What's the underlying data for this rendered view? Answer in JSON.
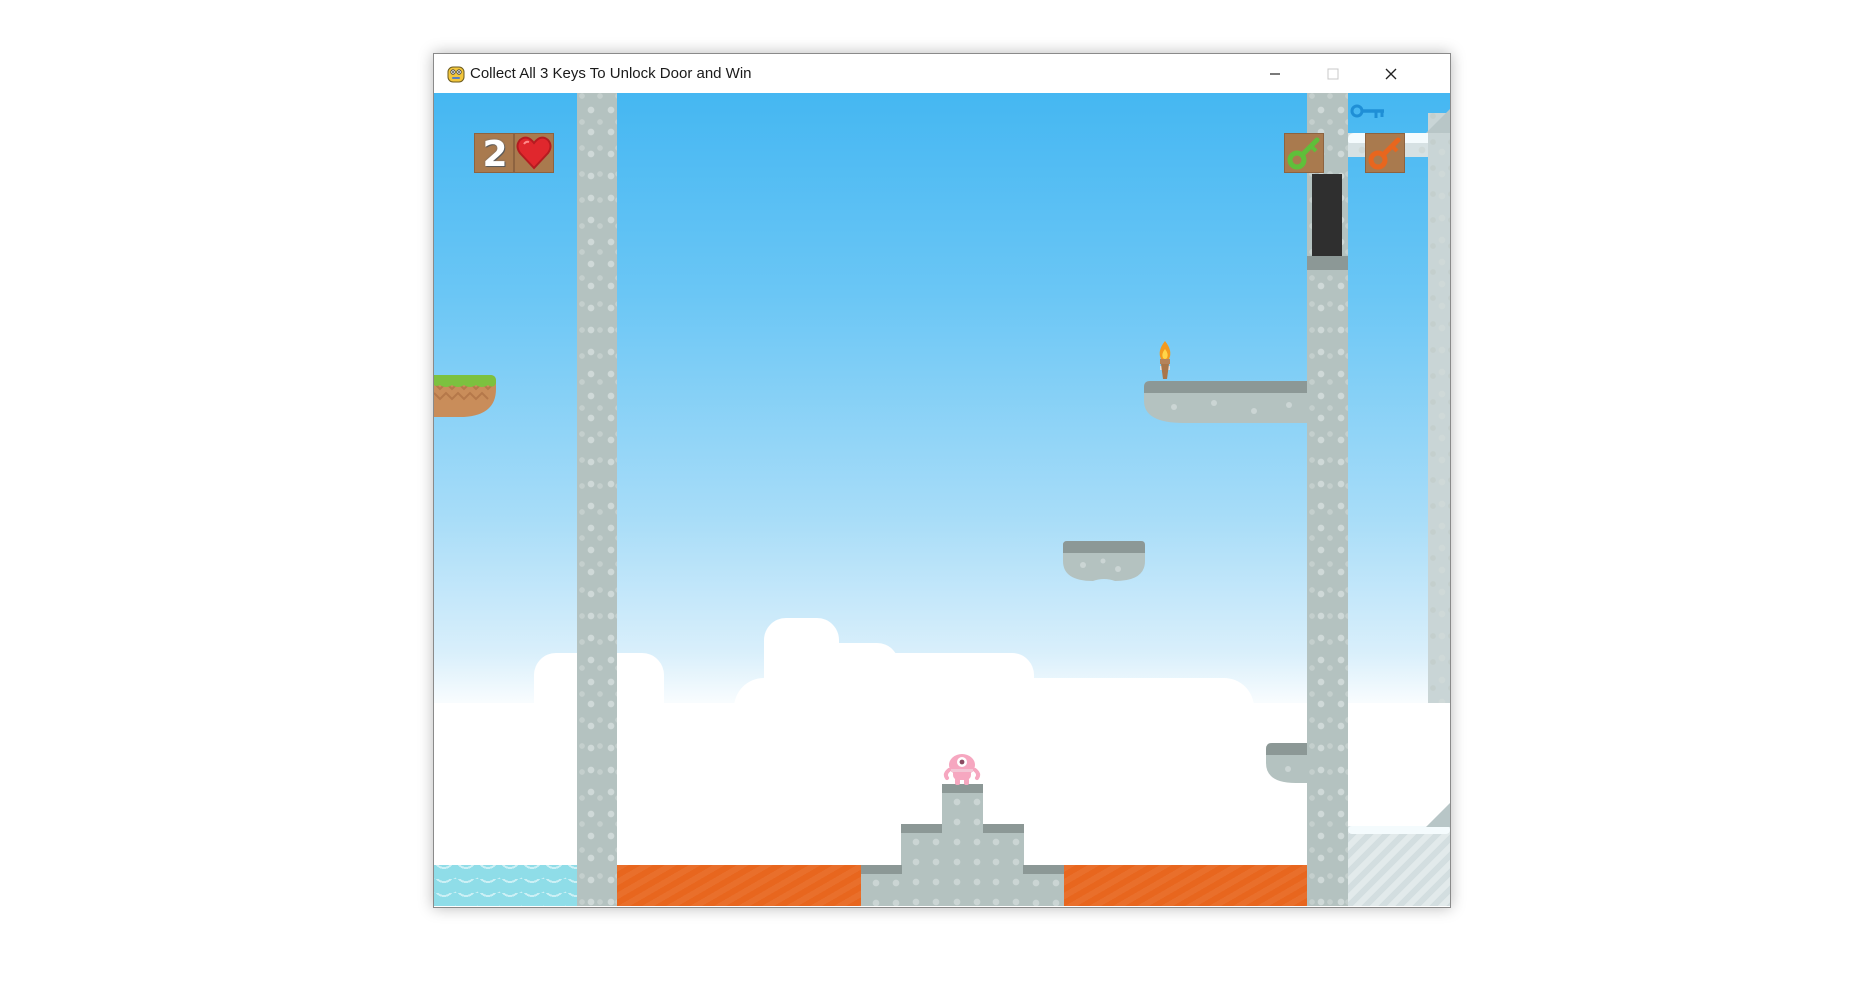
{
  "window": {
    "title": "Collect All 3 Keys To Unlock Door and Win",
    "app_icon": "pygame-snake-icon",
    "controls": [
      "minimize-icon",
      "maximize-icon",
      "close-icon"
    ]
  },
  "hud": {
    "lives": "2",
    "life_icon": "heart-icon",
    "keys": [
      {
        "name": "green-key-icon",
        "color": "#5fbf3a"
      },
      {
        "name": "orange-key-icon",
        "color": "#e8661e"
      },
      {
        "name": "blue-key-icon",
        "color": "#1f8fd6"
      }
    ]
  },
  "colors": {
    "sky_top": "#45b7f2",
    "lava": "#e8661e",
    "water": "#8fdde8",
    "stone": "#b4c2c0",
    "grass": "#7cc13f",
    "dirt": "#c98d5a",
    "player": "#f6a7c0"
  },
  "sprites": {
    "player": "pink-alien-player",
    "torch": "torch-icon",
    "door": "locked-door"
  }
}
